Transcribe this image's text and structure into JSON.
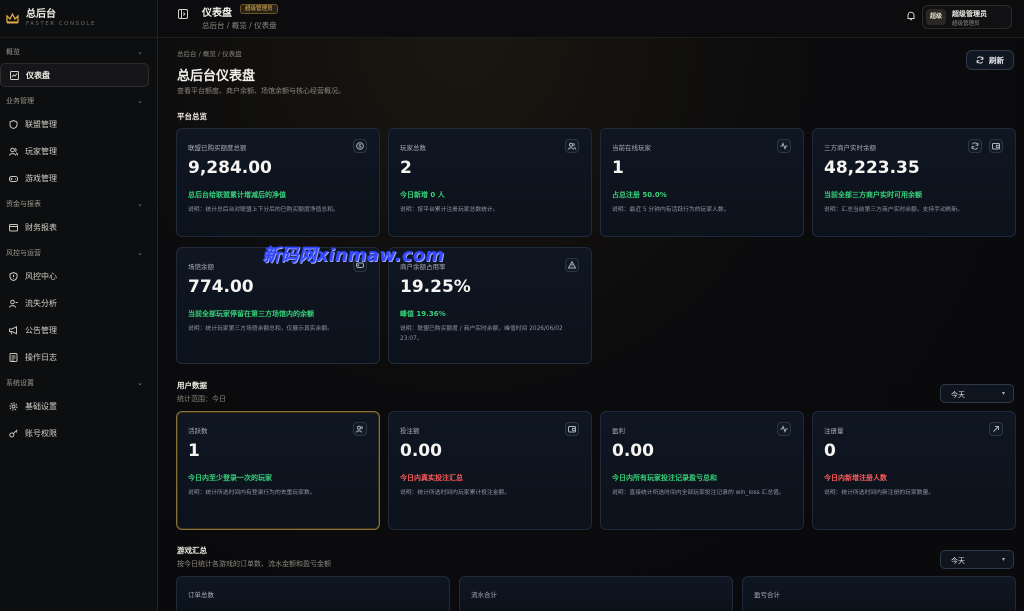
{
  "brand": {
    "title": "总后台",
    "subtitle": "FASTER CONSOLE"
  },
  "sidebar": {
    "groups": [
      {
        "label": "概览",
        "items": [
          {
            "label": "仪表盘",
            "icon": "dashboard-icon"
          }
        ]
      },
      {
        "label": "业务管理",
        "items": [
          {
            "label": "联盟管理",
            "icon": "shield-icon"
          },
          {
            "label": "玩家管理",
            "icon": "users-icon"
          },
          {
            "label": "游戏管理",
            "icon": "gamepad-icon"
          }
        ]
      },
      {
        "label": "资金与报表",
        "items": [
          {
            "label": "财务报表",
            "icon": "wallet-icon"
          }
        ]
      },
      {
        "label": "风控与运营",
        "items": [
          {
            "label": "风控中心",
            "icon": "shield-alert-icon"
          },
          {
            "label": "流失分析",
            "icon": "user-minus-icon"
          },
          {
            "label": "公告管理",
            "icon": "megaphone-icon"
          },
          {
            "label": "操作日志",
            "icon": "log-icon"
          }
        ]
      },
      {
        "label": "系统设置",
        "items": [
          {
            "label": "基础设置",
            "icon": "gear-icon"
          },
          {
            "label": "账号权限",
            "icon": "key-icon"
          }
        ]
      }
    ]
  },
  "topbar": {
    "title": "仪表盘",
    "badge": "超级管理员",
    "breadcrumb": "总后台 / 概览 / 仪表盘",
    "user": {
      "avatar": "超级",
      "name": "超级管理员",
      "role": "超级管理员"
    }
  },
  "page": {
    "breadcrumb": "总后台 / 概览 / 仪表盘",
    "title": "总后台仪表盘",
    "subtitle": "查看平台额度、商户余额、场馆余额与核心经营概况。",
    "refresh_label": "刷新"
  },
  "platform": {
    "heading": "平台总览",
    "cards": [
      {
        "label": "联盟已购买额度总额",
        "value": "9,284.00",
        "highlight": "总后台给联盟累计增减后的净值",
        "desc": "说明：统计总后台对联盟上下分后的已购买额度净值总和。",
        "tone": "green"
      },
      {
        "label": "玩家总数",
        "value": "2",
        "highlight": "今日新增 0 人",
        "desc": "说明：按平台累计注册玩家总数统计。",
        "tone": "green"
      },
      {
        "label": "当前在线玩家",
        "value": "1",
        "highlight": "占总注册 50.0%",
        "desc": "说明：最近 5 分钟内有活跃行为的玩家人数。",
        "tone": "green"
      },
      {
        "label": "三方商户实时余额",
        "value": "48,223.35",
        "highlight": "当前全部三方商户实时可用余额",
        "desc": "说明：汇总当前第三方商户实时余额，支持手动刷新。",
        "tone": "green"
      },
      {
        "label": "场馆余额",
        "value": "774.00",
        "highlight": "当前全部玩家停留在第三方场馆内的余额",
        "desc": "说明：统计玩家第三方场馆余额总和，仅展示真实余额。",
        "tone": "green"
      },
      {
        "label": "商户余额占用率",
        "value": "19.25%",
        "highlight": "峰值 19.36%",
        "desc": "说明：联盟已购买额度 / 商户实时余额，峰值时间 2026/06/02 23:07。",
        "tone": "green"
      }
    ]
  },
  "user_data": {
    "heading": "用户数据",
    "range": "统计范围：今日",
    "select": "今天",
    "cards": [
      {
        "label": "活跃数",
        "value": "1",
        "highlight": "今日内至少登录一次的玩家",
        "desc": "说明：统计所选时间内有登录行为的去重玩家数。",
        "tone": "green"
      },
      {
        "label": "投注额",
        "value": "0.00",
        "highlight": "今日内真实投注汇总",
        "desc": "说明：统计所选时间内玩家累计投注金额。",
        "tone": "red"
      },
      {
        "label": "盈利",
        "value": "0.00",
        "highlight": "今日内所有玩家投注记录盈亏总和",
        "desc": "说明：直接统计所选时间内全部玩家投注记录的 win_loss 汇总值。",
        "tone": "green"
      },
      {
        "label": "注册量",
        "value": "0",
        "highlight": "今日内新增注册人数",
        "desc": "说明：统计所选时间内新注册的玩家数量。",
        "tone": "red"
      }
    ]
  },
  "game_summary": {
    "heading": "游戏汇总",
    "subtitle": "按今日统计各游戏的订单数、流水金额和盈亏金额",
    "select": "今天",
    "cards": [
      {
        "label": "订单总数"
      },
      {
        "label": "流水合计"
      },
      {
        "label": "盈亏合计"
      }
    ]
  },
  "watermark": "新码网xinmaw.com",
  "colors": {
    "gold": "#d9a542",
    "green": "#37d27a",
    "red": "#ff5a5a",
    "card_bg": "#0f1622",
    "card_border": "#1f2a3a"
  }
}
